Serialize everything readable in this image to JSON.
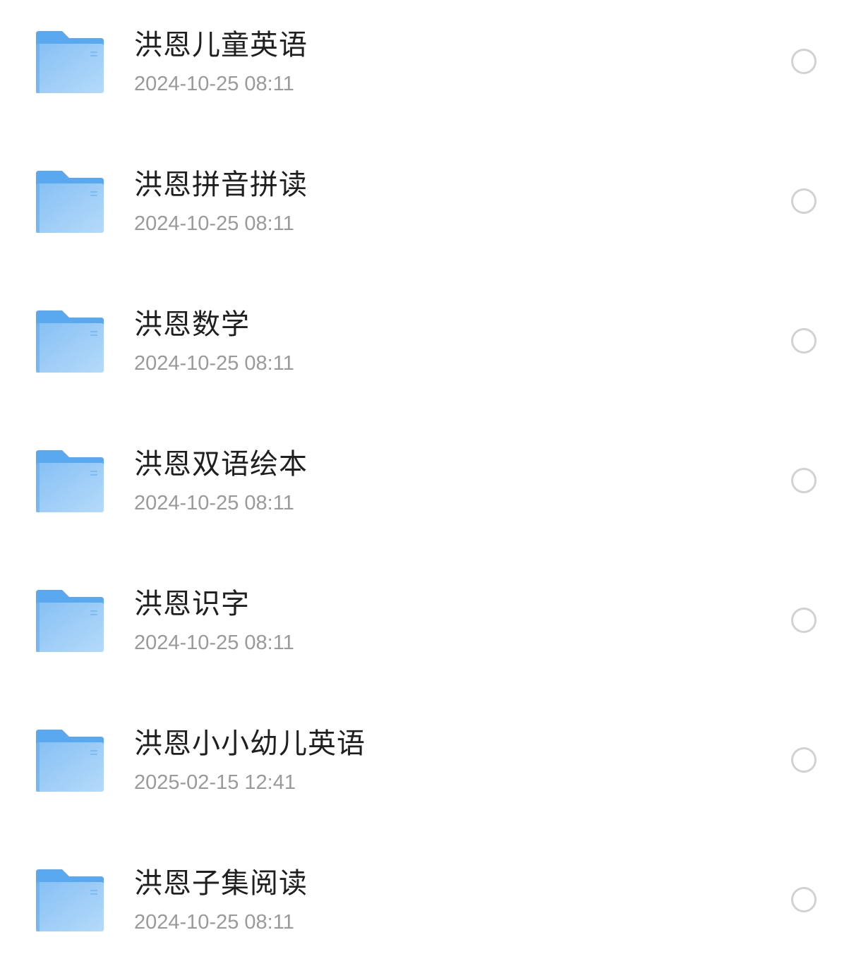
{
  "icons": {
    "folder": "folder-icon",
    "select": "radio-circle-icon"
  },
  "colors": {
    "folder_back": "#5aa8f0",
    "folder_front_top": "#86c0f4",
    "folder_front_bottom": "#b5dafa",
    "name_text": "#1f1f1f",
    "date_text": "#9a9a9a",
    "radio_border": "#d2d2d2"
  },
  "files": [
    {
      "name": "洪恩儿童英语",
      "date": "2024-10-25 08:11"
    },
    {
      "name": "洪恩拼音拼读",
      "date": "2024-10-25 08:11"
    },
    {
      "name": "洪恩数学",
      "date": "2024-10-25 08:11"
    },
    {
      "name": "洪恩双语绘本",
      "date": "2024-10-25 08:11"
    },
    {
      "name": "洪恩识字",
      "date": "2024-10-25 08:11"
    },
    {
      "name": "洪恩小小幼儿英语",
      "date": "2025-02-15 12:41"
    },
    {
      "name": "洪恩子集阅读",
      "date": "2024-10-25 08:11"
    }
  ]
}
